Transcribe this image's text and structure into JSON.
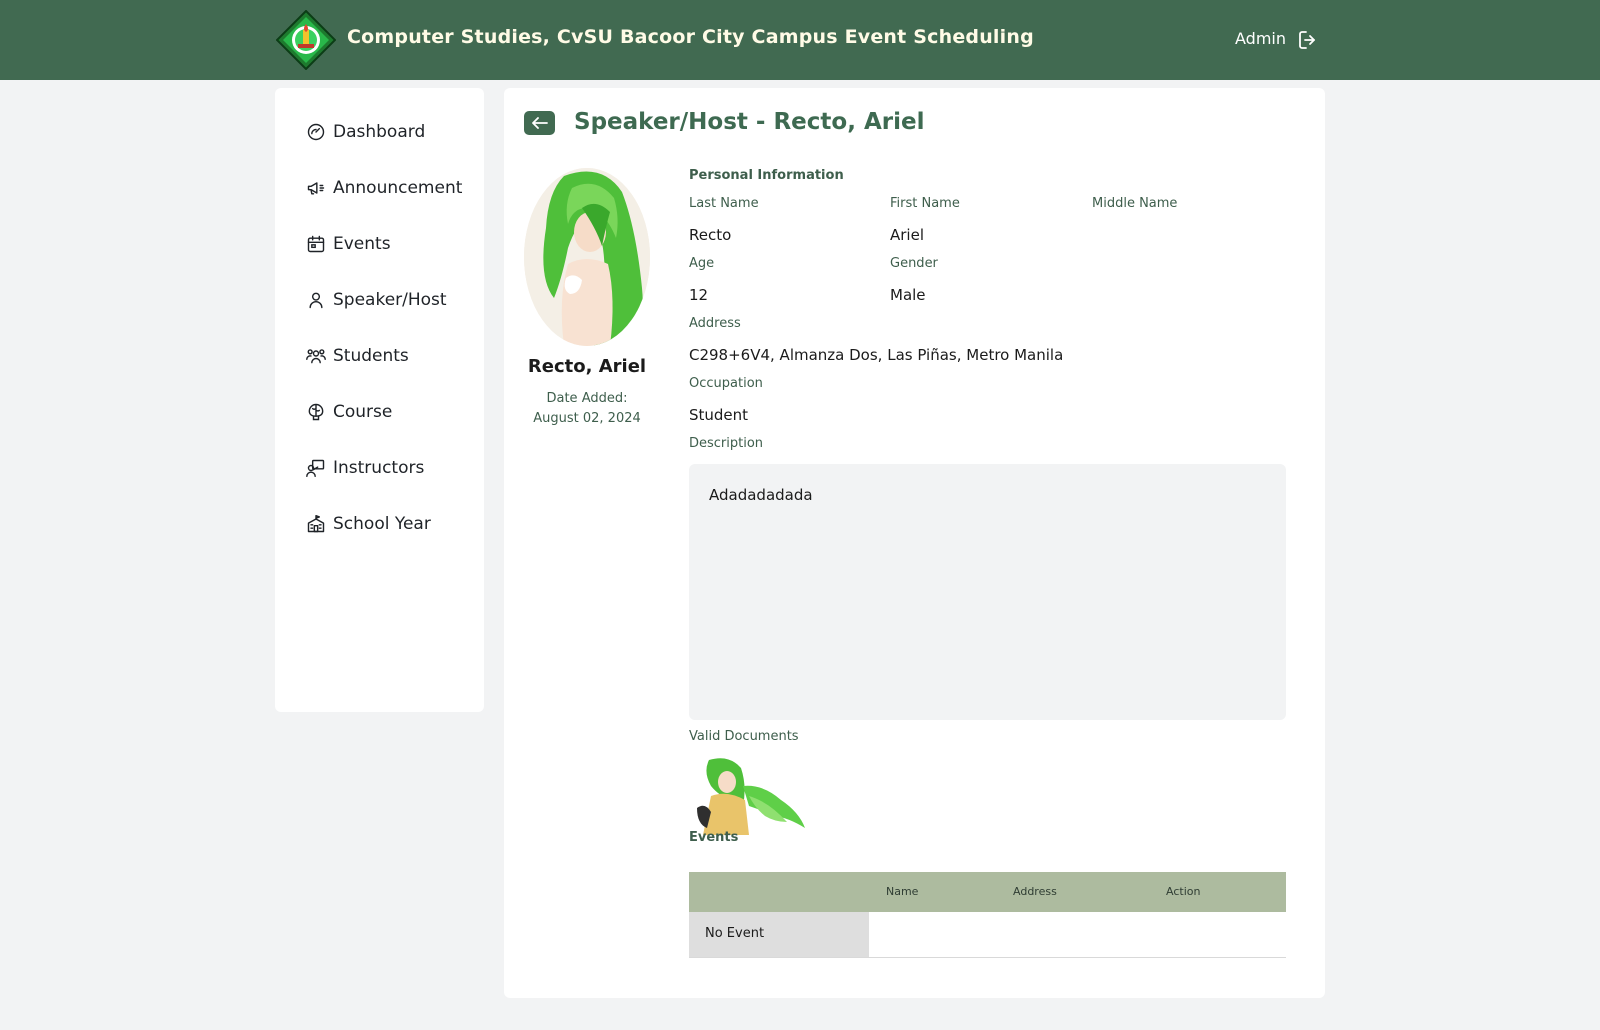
{
  "header": {
    "title": "Computer Studies, CvSU Bacoor City Campus Event Scheduling",
    "user": "Admin",
    "logo_icon": "university-seal-logo",
    "logout_icon": "logout-icon"
  },
  "sidebar": {
    "items": [
      {
        "label": "Dashboard",
        "icon": "gauge-icon"
      },
      {
        "label": "Announcement",
        "icon": "megaphone-icon"
      },
      {
        "label": "Events",
        "icon": "calendar-icon"
      },
      {
        "label": "Speaker/Host",
        "icon": "user-icon"
      },
      {
        "label": "Students",
        "icon": "users-icon"
      },
      {
        "label": "Course",
        "icon": "brain-icon"
      },
      {
        "label": "Instructors",
        "icon": "presenter-icon"
      },
      {
        "label": "School Year",
        "icon": "school-icon"
      }
    ]
  },
  "page": {
    "title": "Speaker/Host - Recto, Ariel",
    "back_icon": "arrow-left-icon"
  },
  "profile": {
    "name": "Recto, Ariel",
    "date_added_label": "Date Added:",
    "date_added": "August 02, 2024"
  },
  "personal": {
    "section_title": "Personal Information",
    "last_name_label": "Last Name",
    "last_name": "Recto",
    "first_name_label": "First Name",
    "first_name": "Ariel",
    "middle_name_label": "Middle Name",
    "middle_name": "",
    "age_label": "Age",
    "age": "12",
    "gender_label": "Gender",
    "gender": "Male",
    "address_label": "Address",
    "address": "C298+6V4, Almanza Dos, Las Piñas, Metro Manila",
    "occupation_label": "Occupation",
    "occupation": "Student",
    "description_label": "Description",
    "description": "Adadadadada"
  },
  "documents": {
    "label": "Valid Documents"
  },
  "events": {
    "section_title": "Events",
    "columns": [
      "Name",
      "Address",
      "Action"
    ],
    "empty_text": "No Event"
  },
  "colors": {
    "header_green": "#416a51",
    "title_green": "#3e6a51",
    "table_header": "#adbb9f",
    "background": "#f2f3f4"
  }
}
